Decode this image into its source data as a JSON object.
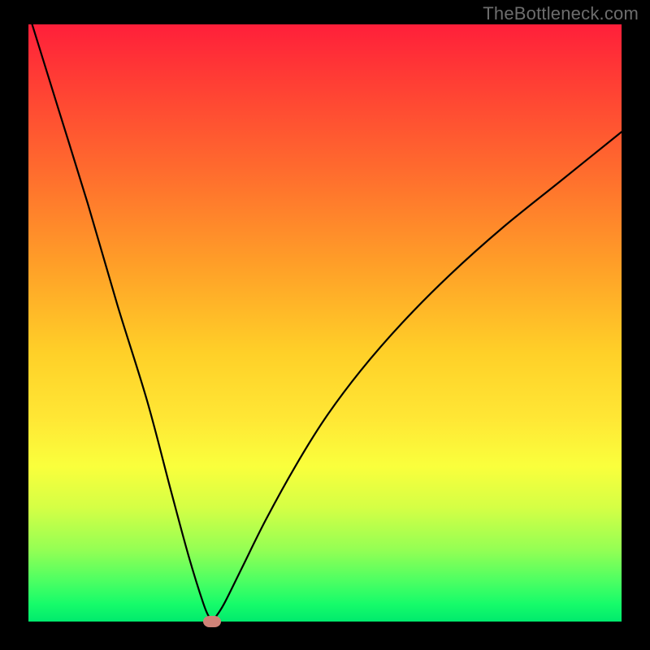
{
  "watermark": {
    "text": "TheBottleneck.com"
  },
  "chart_data": {
    "type": "line",
    "title": "",
    "xlabel": "",
    "ylabel": "",
    "xlim": [
      0,
      1
    ],
    "ylim": [
      0,
      1
    ],
    "grid": false,
    "legend": false,
    "series": [
      {
        "name": "bottleneck-curve",
        "x": [
          0.0,
          0.05,
          0.1,
          0.15,
          0.2,
          0.24,
          0.27,
          0.295,
          0.305,
          0.31,
          0.315,
          0.33,
          0.36,
          0.4,
          0.45,
          0.5,
          0.56,
          0.63,
          0.71,
          0.8,
          0.9,
          1.0
        ],
        "values": [
          1.02,
          0.86,
          0.7,
          0.53,
          0.37,
          0.22,
          0.11,
          0.03,
          0.007,
          0.004,
          0.007,
          0.03,
          0.09,
          0.17,
          0.26,
          0.34,
          0.42,
          0.5,
          0.58,
          0.66,
          0.74,
          0.82
        ]
      }
    ],
    "annotations": [
      {
        "name": "optimal-marker",
        "x": 0.31,
        "y": 0.0
      }
    ],
    "background_gradient_stops": [
      {
        "pos": 0.0,
        "color": "#ff1f3a"
      },
      {
        "pos": 0.55,
        "color": "#ffd028"
      },
      {
        "pos": 0.8,
        "color": "#d4ff45"
      },
      {
        "pos": 1.0,
        "color": "#00ea6d"
      }
    ]
  }
}
